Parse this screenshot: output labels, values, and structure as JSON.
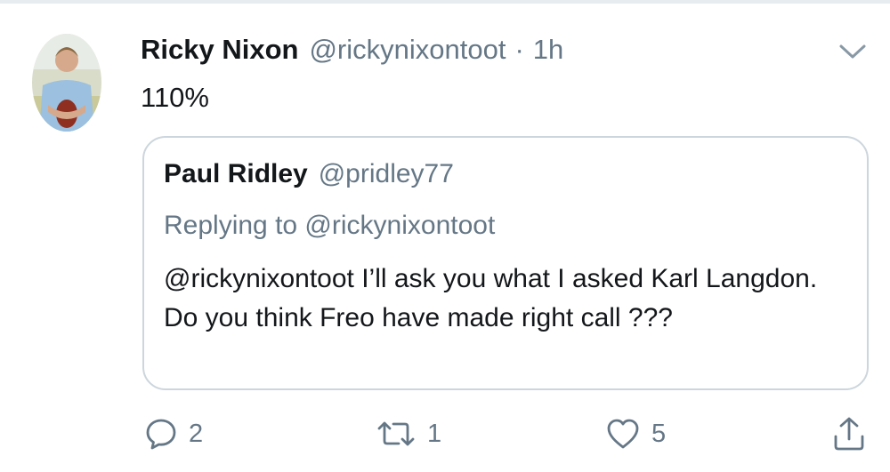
{
  "tweet": {
    "author_name": "Ricky Nixon",
    "author_handle": "@rickynixontoot",
    "separator": "·",
    "time": "1h",
    "text": "110%"
  },
  "quoted_tweet": {
    "author_name": "Paul Ridley",
    "author_handle": "@pridley77",
    "replying_to": "Replying to @rickynixontoot",
    "text": "@rickynixontoot I’ll ask you what I asked Karl Langdon. Do you think Freo have made right call ???"
  },
  "actions": {
    "reply_count": "2",
    "retweet_count": "1",
    "like_count": "5"
  },
  "icons": {
    "caret": "chevron-down-icon",
    "reply": "reply-icon",
    "retweet": "retweet-icon",
    "like": "heart-icon",
    "share": "share-icon"
  },
  "colors": {
    "text": "#14171a",
    "secondary": "#657786",
    "border": "#ccd6dd"
  }
}
